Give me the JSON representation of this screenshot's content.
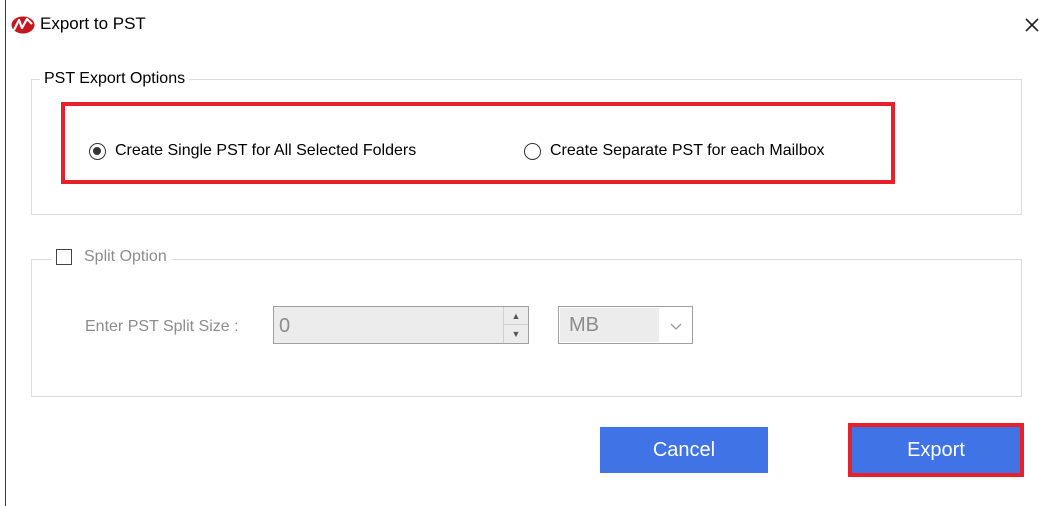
{
  "window": {
    "title": "Export to PST",
    "app_icon": "app-logo-icon",
    "close_icon": "close-icon"
  },
  "export_options": {
    "legend": "PST Export Options",
    "options": [
      {
        "label": "Create Single PST for All Selected Folders",
        "selected": true
      },
      {
        "label": "Create Separate PST for each Mailbox",
        "selected": false
      }
    ]
  },
  "split": {
    "legend": "Split Option",
    "enabled": false,
    "size_label": "Enter PST Split Size :",
    "size_value": "0",
    "unit_value": "MB"
  },
  "buttons": {
    "cancel": "Cancel",
    "export": "Export"
  },
  "colors": {
    "accent": "#3f73e6",
    "highlight": "#e8202a",
    "disabled_text": "#8c8c8c"
  }
}
